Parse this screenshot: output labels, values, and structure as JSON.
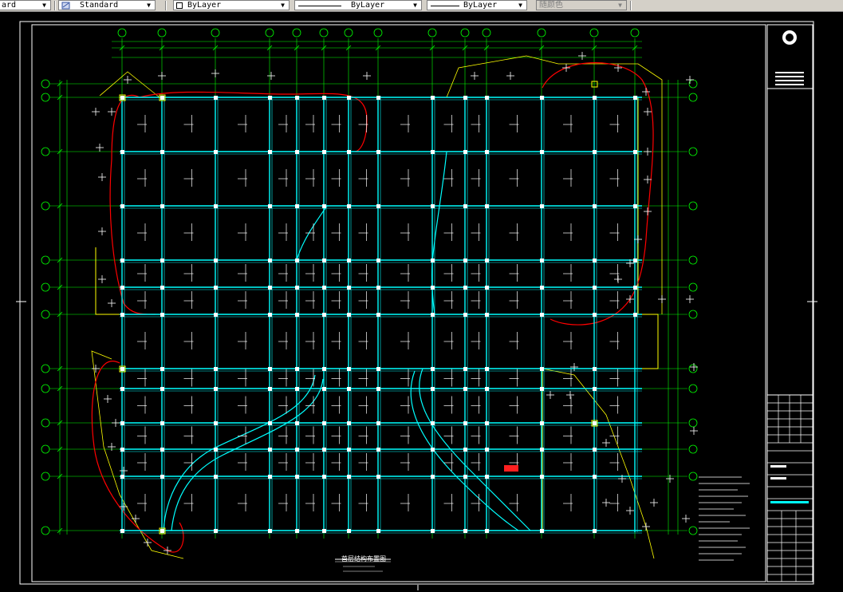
{
  "toolbar": {
    "textstyle_value": "ard",
    "dimstyle_value": "Standard",
    "layer_value": "ByLayer",
    "linetype_value": "ByLayer",
    "lineweight_value": "ByLayer",
    "plotstyle_value": "随颜色"
  },
  "drawing": {
    "grid_columns": [
      "1a",
      "1",
      "2",
      "3",
      "3a",
      "4",
      "4a",
      "5",
      "6",
      "6a",
      "7",
      "8",
      "9",
      "9a"
    ],
    "grid_rows": [
      "Ja",
      "J",
      "H",
      "G",
      "F",
      "Ea",
      "E",
      "D",
      "Da",
      "C",
      "Ca",
      "B",
      "A"
    ],
    "title": "首层结构布置图",
    "scale_note": "比例 1:100",
    "titleblock_logo_text": "中国华北\n建筑设计有限公司",
    "drawing_no": "结施-02"
  },
  "colors": {
    "background": "#000000",
    "grid_axis": "#00ff00",
    "beam": "#00ffff",
    "column": "#ffffff",
    "wall": "#ffff00",
    "boundary": "#ff0000",
    "marker": "#ffffff"
  }
}
